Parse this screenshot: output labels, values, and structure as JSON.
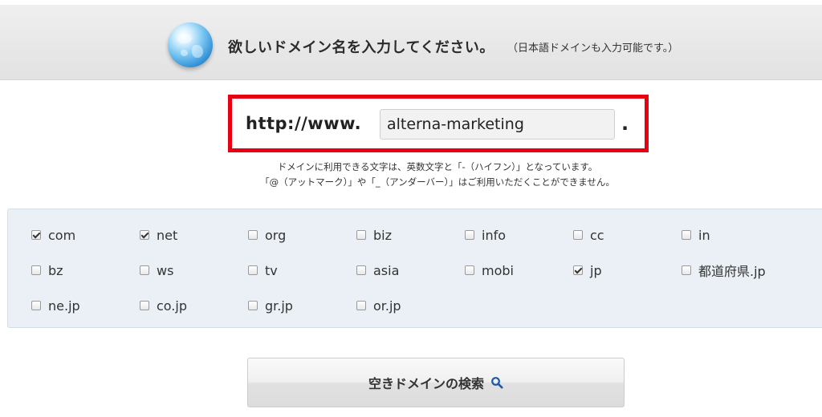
{
  "header": {
    "title": "欲しいドメイン名を入力してください。",
    "note": "（日本語ドメインも入力可能です。）",
    "icon": "globe-icon"
  },
  "url": {
    "prefix": "http://www.",
    "value": "alterna-marketing",
    "suffix": ".",
    "highlight_color": "#e60012"
  },
  "notice": {
    "line1": "ドメインに利用できる文字は、英数文字と「-（ハイフン）」となっています。",
    "line2": "「@（アットマーク）」や「_（アンダーバー）」はご利用いただくことができません。"
  },
  "tlds": [
    {
      "label": "com",
      "checked": true
    },
    {
      "label": "net",
      "checked": true
    },
    {
      "label": "org",
      "checked": false
    },
    {
      "label": "biz",
      "checked": false
    },
    {
      "label": "info",
      "checked": false
    },
    {
      "label": "cc",
      "checked": false
    },
    {
      "label": "in",
      "checked": false
    },
    {
      "label": "bz",
      "checked": false
    },
    {
      "label": "ws",
      "checked": false
    },
    {
      "label": "tv",
      "checked": false
    },
    {
      "label": "asia",
      "checked": false
    },
    {
      "label": "mobi",
      "checked": false
    },
    {
      "label": "jp",
      "checked": true
    },
    {
      "label": "都道府県.jp",
      "checked": false
    },
    {
      "label": "ne.jp",
      "checked": false
    },
    {
      "label": "co.jp",
      "checked": false
    },
    {
      "label": "gr.jp",
      "checked": false
    },
    {
      "label": "or.jp",
      "checked": false
    }
  ],
  "search": {
    "label": "空きドメインの検索",
    "icon": "search-icon",
    "icon_color": "#1a5aa8"
  }
}
